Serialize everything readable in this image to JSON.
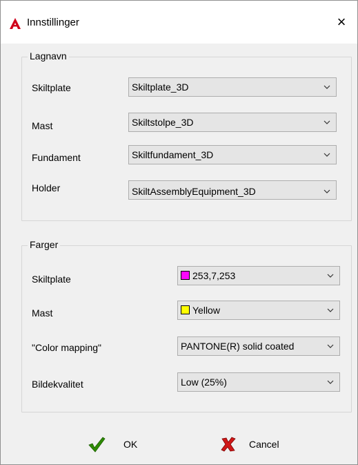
{
  "window": {
    "title": "Innstillinger",
    "close_glyph": "×",
    "app_icon": "autocad-logo-icon"
  },
  "layer_names": {
    "group_title": "Lagnavn",
    "rows": [
      {
        "label": "Skiltplate",
        "value": "Skiltplate_3D"
      },
      {
        "label": "Mast",
        "value": "Skiltstolpe_3D"
      },
      {
        "label": "Fundament",
        "value": "Skiltfundament_3D"
      },
      {
        "label": "Holder",
        "value": "SkiltAssemblyEquipment_3D"
      }
    ]
  },
  "colors": {
    "group_title": "Farger",
    "rows": [
      {
        "label": "Skiltplate",
        "value": "253,7,253",
        "swatch": "#fd07fd"
      },
      {
        "label": "Mast",
        "value": "Yellow",
        "swatch": "#ffff00"
      },
      {
        "label": "\"Color mapping\"",
        "value": "PANTONE(R) solid coated"
      },
      {
        "label": "Bildekvalitet",
        "value": "Low (25%)"
      }
    ]
  },
  "buttons": {
    "ok": {
      "label": "OK",
      "icon": "green-checkmark-icon"
    },
    "cancel": {
      "label": "Cancel",
      "icon": "red-x-icon"
    }
  },
  "palette": {
    "accent_red": "#d0021b",
    "check_green": "#2e8b00"
  }
}
